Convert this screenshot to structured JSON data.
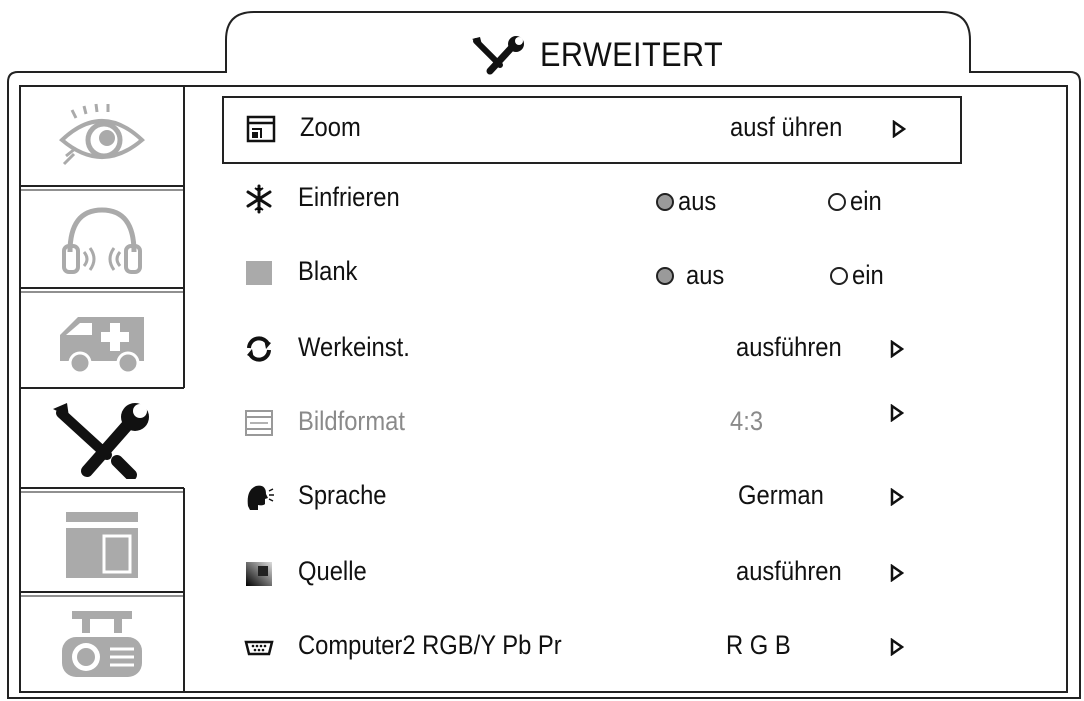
{
  "header": {
    "title": "ERWEITERT",
    "icon": "tools-icon"
  },
  "tabs": [
    {
      "name": "image-tab",
      "icon": "eye-icon"
    },
    {
      "name": "audio-tab",
      "icon": "headphones-icon"
    },
    {
      "name": "service-tab",
      "icon": "ambulance-icon"
    },
    {
      "name": "advanced-tab",
      "icon": "tools-icon",
      "active": true
    },
    {
      "name": "layout-tab",
      "icon": "window-layout-icon"
    },
    {
      "name": "projector-tab",
      "icon": "projector-icon"
    }
  ],
  "menu": {
    "zoom": {
      "label": "Zoom",
      "value": "ausf ühren",
      "icon": "zoom-icon"
    },
    "freeze": {
      "label": "Einfrieren",
      "opt_off": "aus",
      "opt_on": "ein",
      "selected": "aus",
      "icon": "snowflake-icon"
    },
    "blank": {
      "label": "Blank",
      "opt_off": "aus",
      "opt_on": "ein",
      "selected": "aus",
      "icon": "blank-square-icon"
    },
    "reset": {
      "label": "Werkeinst.",
      "value": "ausführen",
      "icon": "reset-arrows-icon"
    },
    "aspect": {
      "label": "Bildformat",
      "value": "4:3",
      "icon": "aspect-ratio-icon"
    },
    "language": {
      "label": "Sprache",
      "value": "German",
      "icon": "speaking-head-icon"
    },
    "source": {
      "label": "Quelle",
      "value": "ausführen",
      "icon": "source-gradient-icon"
    },
    "computer2": {
      "label": "Computer2 RGB/Y Pb Pr",
      "value": "R G B",
      "icon": "vga-connector-icon"
    }
  }
}
